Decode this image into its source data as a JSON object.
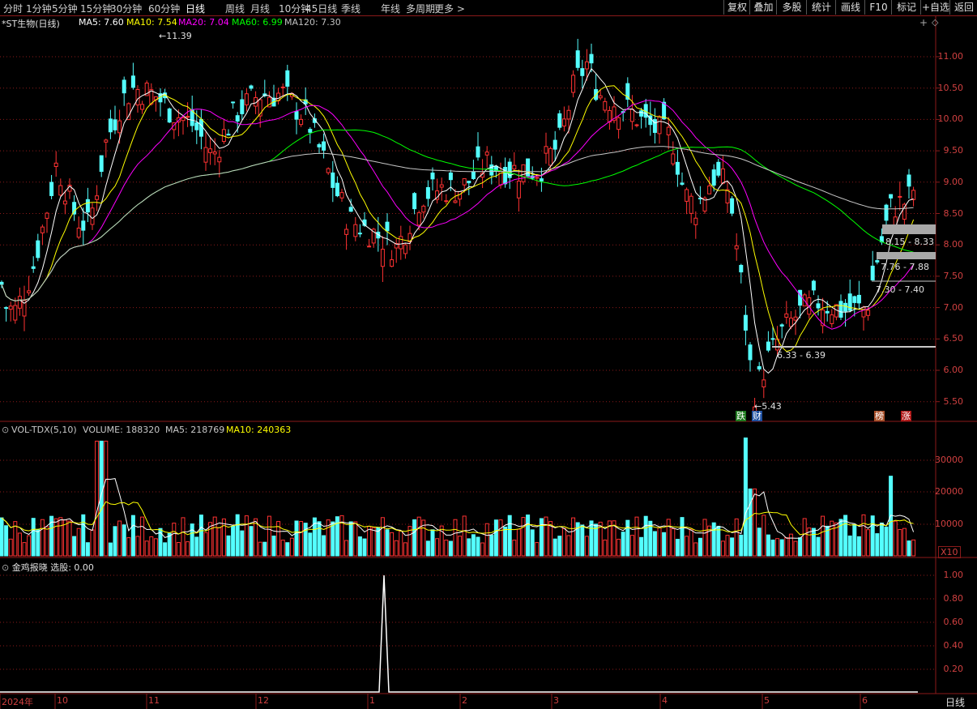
{
  "toolbar": {
    "periods": [
      "分时",
      "1分钟",
      "5分钟",
      "15分钟",
      "30分钟",
      "60分钟",
      "日线",
      "周线",
      "月线",
      "10分钟",
      "45日线",
      "季线",
      "年线",
      "多周期",
      "更多 >"
    ],
    "active": "日线",
    "right_buttons": [
      "复权",
      "叠加",
      "多股",
      "统计",
      "画线",
      "F10",
      "标记",
      "+自选",
      "返回"
    ]
  },
  "main_panel": {
    "title": "*ST生物(日线)",
    "ma_legend": [
      {
        "label": "MA5: 7.60",
        "color": "#ffffff"
      },
      {
        "label": "MA10: 7.54",
        "color": "#ffff00"
      },
      {
        "label": "MA20: 7.04",
        "color": "#ff00ff"
      },
      {
        "label": "MA60: 6.99",
        "color": "#00ff00"
      },
      {
        "label": "MA120: 7.30",
        "color": "#c0c0c0"
      }
    ],
    "y_ticks": [
      "11.00",
      "10.50",
      "10.00",
      "9.50",
      "9.00",
      "8.50",
      "8.00",
      "7.50",
      "7.00",
      "6.50",
      "6.00",
      "5.50"
    ],
    "high_label": "11.39",
    "low_label": "5.43",
    "ranges": [
      "8.15 - 8.33",
      "7.76 - 7.88",
      "7.30 - 7.40",
      "6.33 - 6.39"
    ],
    "markers": [
      {
        "text": "跌",
        "color": "#1e7a1e"
      },
      {
        "text": "财",
        "color": "#1e4fa0"
      },
      {
        "text": "榜",
        "color": "#a8502a"
      },
      {
        "text": "涨",
        "color": "#b01818"
      }
    ],
    "diamond_icon": "◇",
    "cross_icon": "+"
  },
  "vol_panel": {
    "legend": [
      {
        "label": "VOL-TDX(5,10)",
        "color": "#c8c8c8"
      },
      {
        "label": "VOLUME: 188320",
        "color": "#c8c8c8"
      },
      {
        "label": "MA5: 218769",
        "color": "#c8c8c8"
      },
      {
        "label": "MA10: 240363",
        "color": "#ffff00"
      }
    ],
    "y_ticks": [
      "30000",
      "20000",
      "10000"
    ],
    "unit": "X10"
  },
  "ind_panel": {
    "legend": "金鸡报晓  选股: 0.00",
    "y_ticks": [
      "1.00",
      "0.80",
      "0.60",
      "0.40",
      "0.20"
    ]
  },
  "date_axis": {
    "labels": [
      "2024年",
      "10",
      "11",
      "12",
      "1",
      "2",
      "3",
      "4",
      "5",
      "6"
    ],
    "period": "日线"
  },
  "colors": {
    "up": "#ff3232",
    "down": "#54ffff",
    "grid": "#8b1a1a",
    "axis": "#d04040"
  }
}
